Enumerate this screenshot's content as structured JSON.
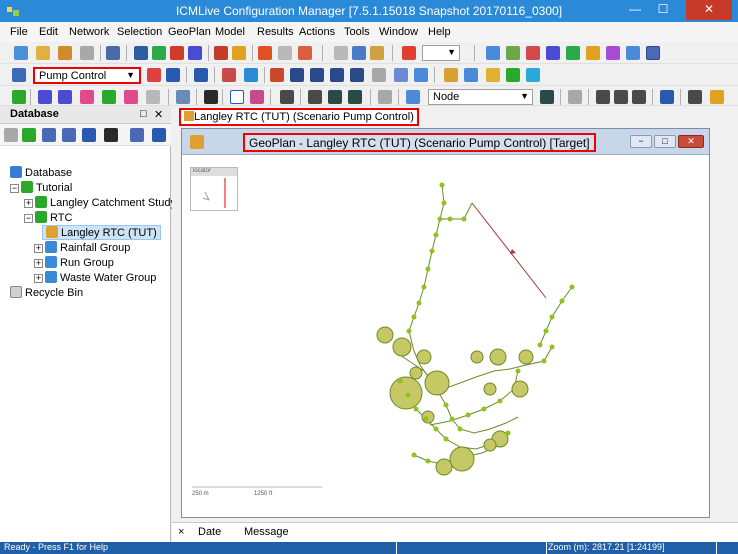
{
  "window": {
    "title": "ICMLive Configuration Manager [7.5.1.15018 Snapshot 20170116_0300]"
  },
  "menu": {
    "items": [
      "File",
      "Edit",
      "Network",
      "Selection",
      "GeoPlan",
      "Model",
      "Results",
      "Actions",
      "Tools",
      "Window",
      "Help"
    ]
  },
  "toolbar": {
    "scenario_selected": "Pump Control",
    "node_selected": "Node"
  },
  "sidebar": {
    "title": "Database",
    "tree": [
      {
        "label": "Database"
      },
      {
        "label": "Tutorial"
      },
      {
        "label": "Langley Catchment Study"
      },
      {
        "label": "RTC"
      },
      {
        "label": "Langley RTC (TUT)"
      },
      {
        "label": "Rainfall Group"
      },
      {
        "label": "Run Group"
      },
      {
        "label": "Waste Water Group"
      },
      {
        "label": "Recycle Bin"
      }
    ]
  },
  "document": {
    "tab_label": "Langley RTC (TUT) (Scenario Pump Control)",
    "geoplan_title": "GeoPlan - Langley RTC (TUT) (Scenario Pump Control)  [Target]",
    "locator_label": "locator",
    "scale_label_1": "250 m",
    "scale_label_2": "1250 ft"
  },
  "messages": {
    "close_glyph": "×",
    "col_date": "Date",
    "col_message": "Message"
  },
  "status": {
    "left": "Ready - Press F1 for Help",
    "zoom": "Zoom (m): 2817.21 [1:24199]"
  },
  "colors": {
    "titlebar": "#2b8ad8",
    "highlight_border": "#e00000",
    "node_fill": "#8dc21f",
    "storage_fill": "#c6c866",
    "link": "#6b8a2a",
    "control_link": "#a33a3a",
    "statusbar": "#1f5fa8"
  },
  "icons": [
    "app-icon",
    "minimize-icon",
    "maximize-icon",
    "close-icon",
    "database-icon",
    "folder-icon",
    "network-icon",
    "rainfall-icon",
    "run-icon",
    "waste-water-icon",
    "recycle-bin-icon"
  ]
}
